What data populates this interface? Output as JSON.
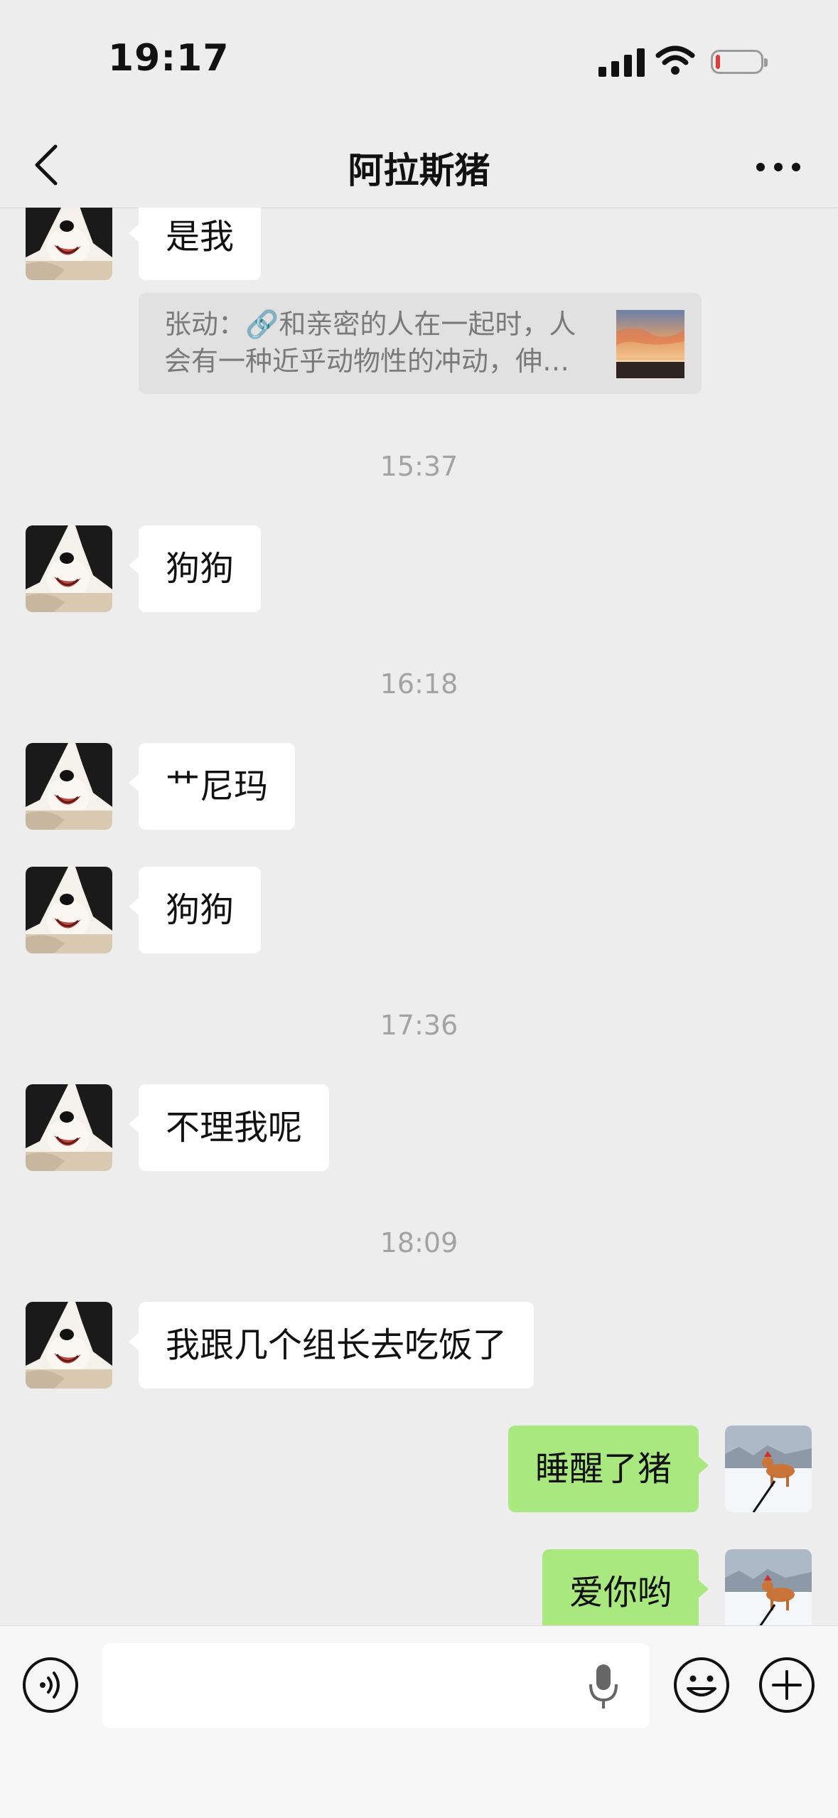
{
  "status_bar": {
    "time": "19:17"
  },
  "header": {
    "title": "阿拉斯猪"
  },
  "messages": [
    {
      "text": "是我"
    },
    {
      "text": "狗狗"
    },
    {
      "text": "艹尼玛"
    },
    {
      "text": "狗狗"
    },
    {
      "text": "不理我呢"
    },
    {
      "text": "我跟几个组长去吃饭了"
    },
    {
      "text": "睡醒了猪"
    },
    {
      "text": "爱你哟"
    }
  ],
  "quote": {
    "line1": "张动：🔗和亲密的人在一起时，人",
    "line2": "会有一种近乎动物性的冲动，伸…"
  },
  "timestamps": [
    "15:37",
    "16:18",
    "17:36",
    "18:09"
  ],
  "input": {
    "placeholder": ""
  },
  "icons": {
    "back": "chevron-left-icon",
    "more": "more-dots-icon",
    "voice": "voice-mode-icon",
    "mic": "microphone-icon",
    "emoji": "emoji-icon",
    "plus": "plus-icon"
  },
  "colors": {
    "background": "#ededed",
    "outgoing_bubble": "#a9e87f",
    "incoming_bubble": "#ffffff",
    "battery_low": "#e53935"
  }
}
